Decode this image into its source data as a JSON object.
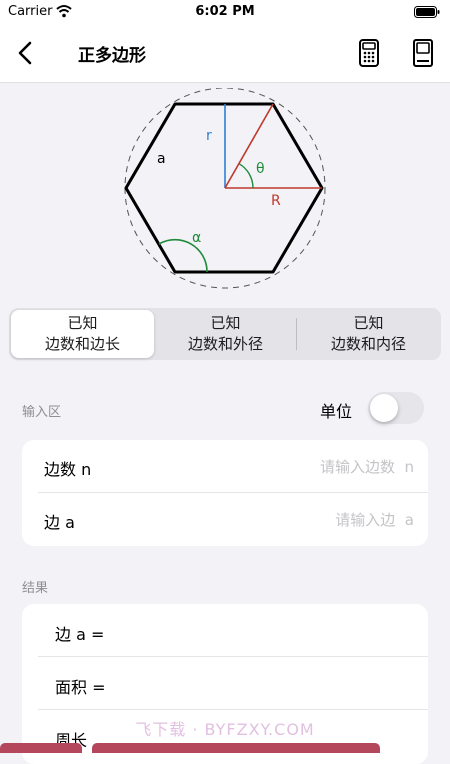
{
  "status": {
    "carrier": "Carrier",
    "time": "6:02 PM"
  },
  "nav": {
    "title": "正多边形"
  },
  "diagram": {
    "labels": {
      "r": "r",
      "a": "a",
      "theta": "θ",
      "R": "R",
      "alpha": "α"
    }
  },
  "tabs": [
    {
      "line1": "已知",
      "line2": "边数和边长",
      "active": true
    },
    {
      "line1": "已知",
      "line2": "边数和外径",
      "active": false
    },
    {
      "line1": "已知",
      "line2": "边数和内径",
      "active": false
    }
  ],
  "input_section": {
    "label": "输入区",
    "unit_label": "单位",
    "unit_toggle_on": false,
    "rows": [
      {
        "label": "边数  n",
        "placeholder": "请输入边数  n"
      },
      {
        "label": "边  a",
        "placeholder": "请输入边  a"
      }
    ]
  },
  "result_section": {
    "label": "结果",
    "rows": [
      {
        "label": "边  a ="
      },
      {
        "label": "面积 ="
      },
      {
        "label": "周长"
      }
    ]
  },
  "watermark": "飞下载 · BYFZXY.COM",
  "colors": {
    "accent_red": "#c0392b",
    "accent_blue": "#2f7fd6",
    "accent_green": "#1e8a3a",
    "button": "#b5475d"
  }
}
